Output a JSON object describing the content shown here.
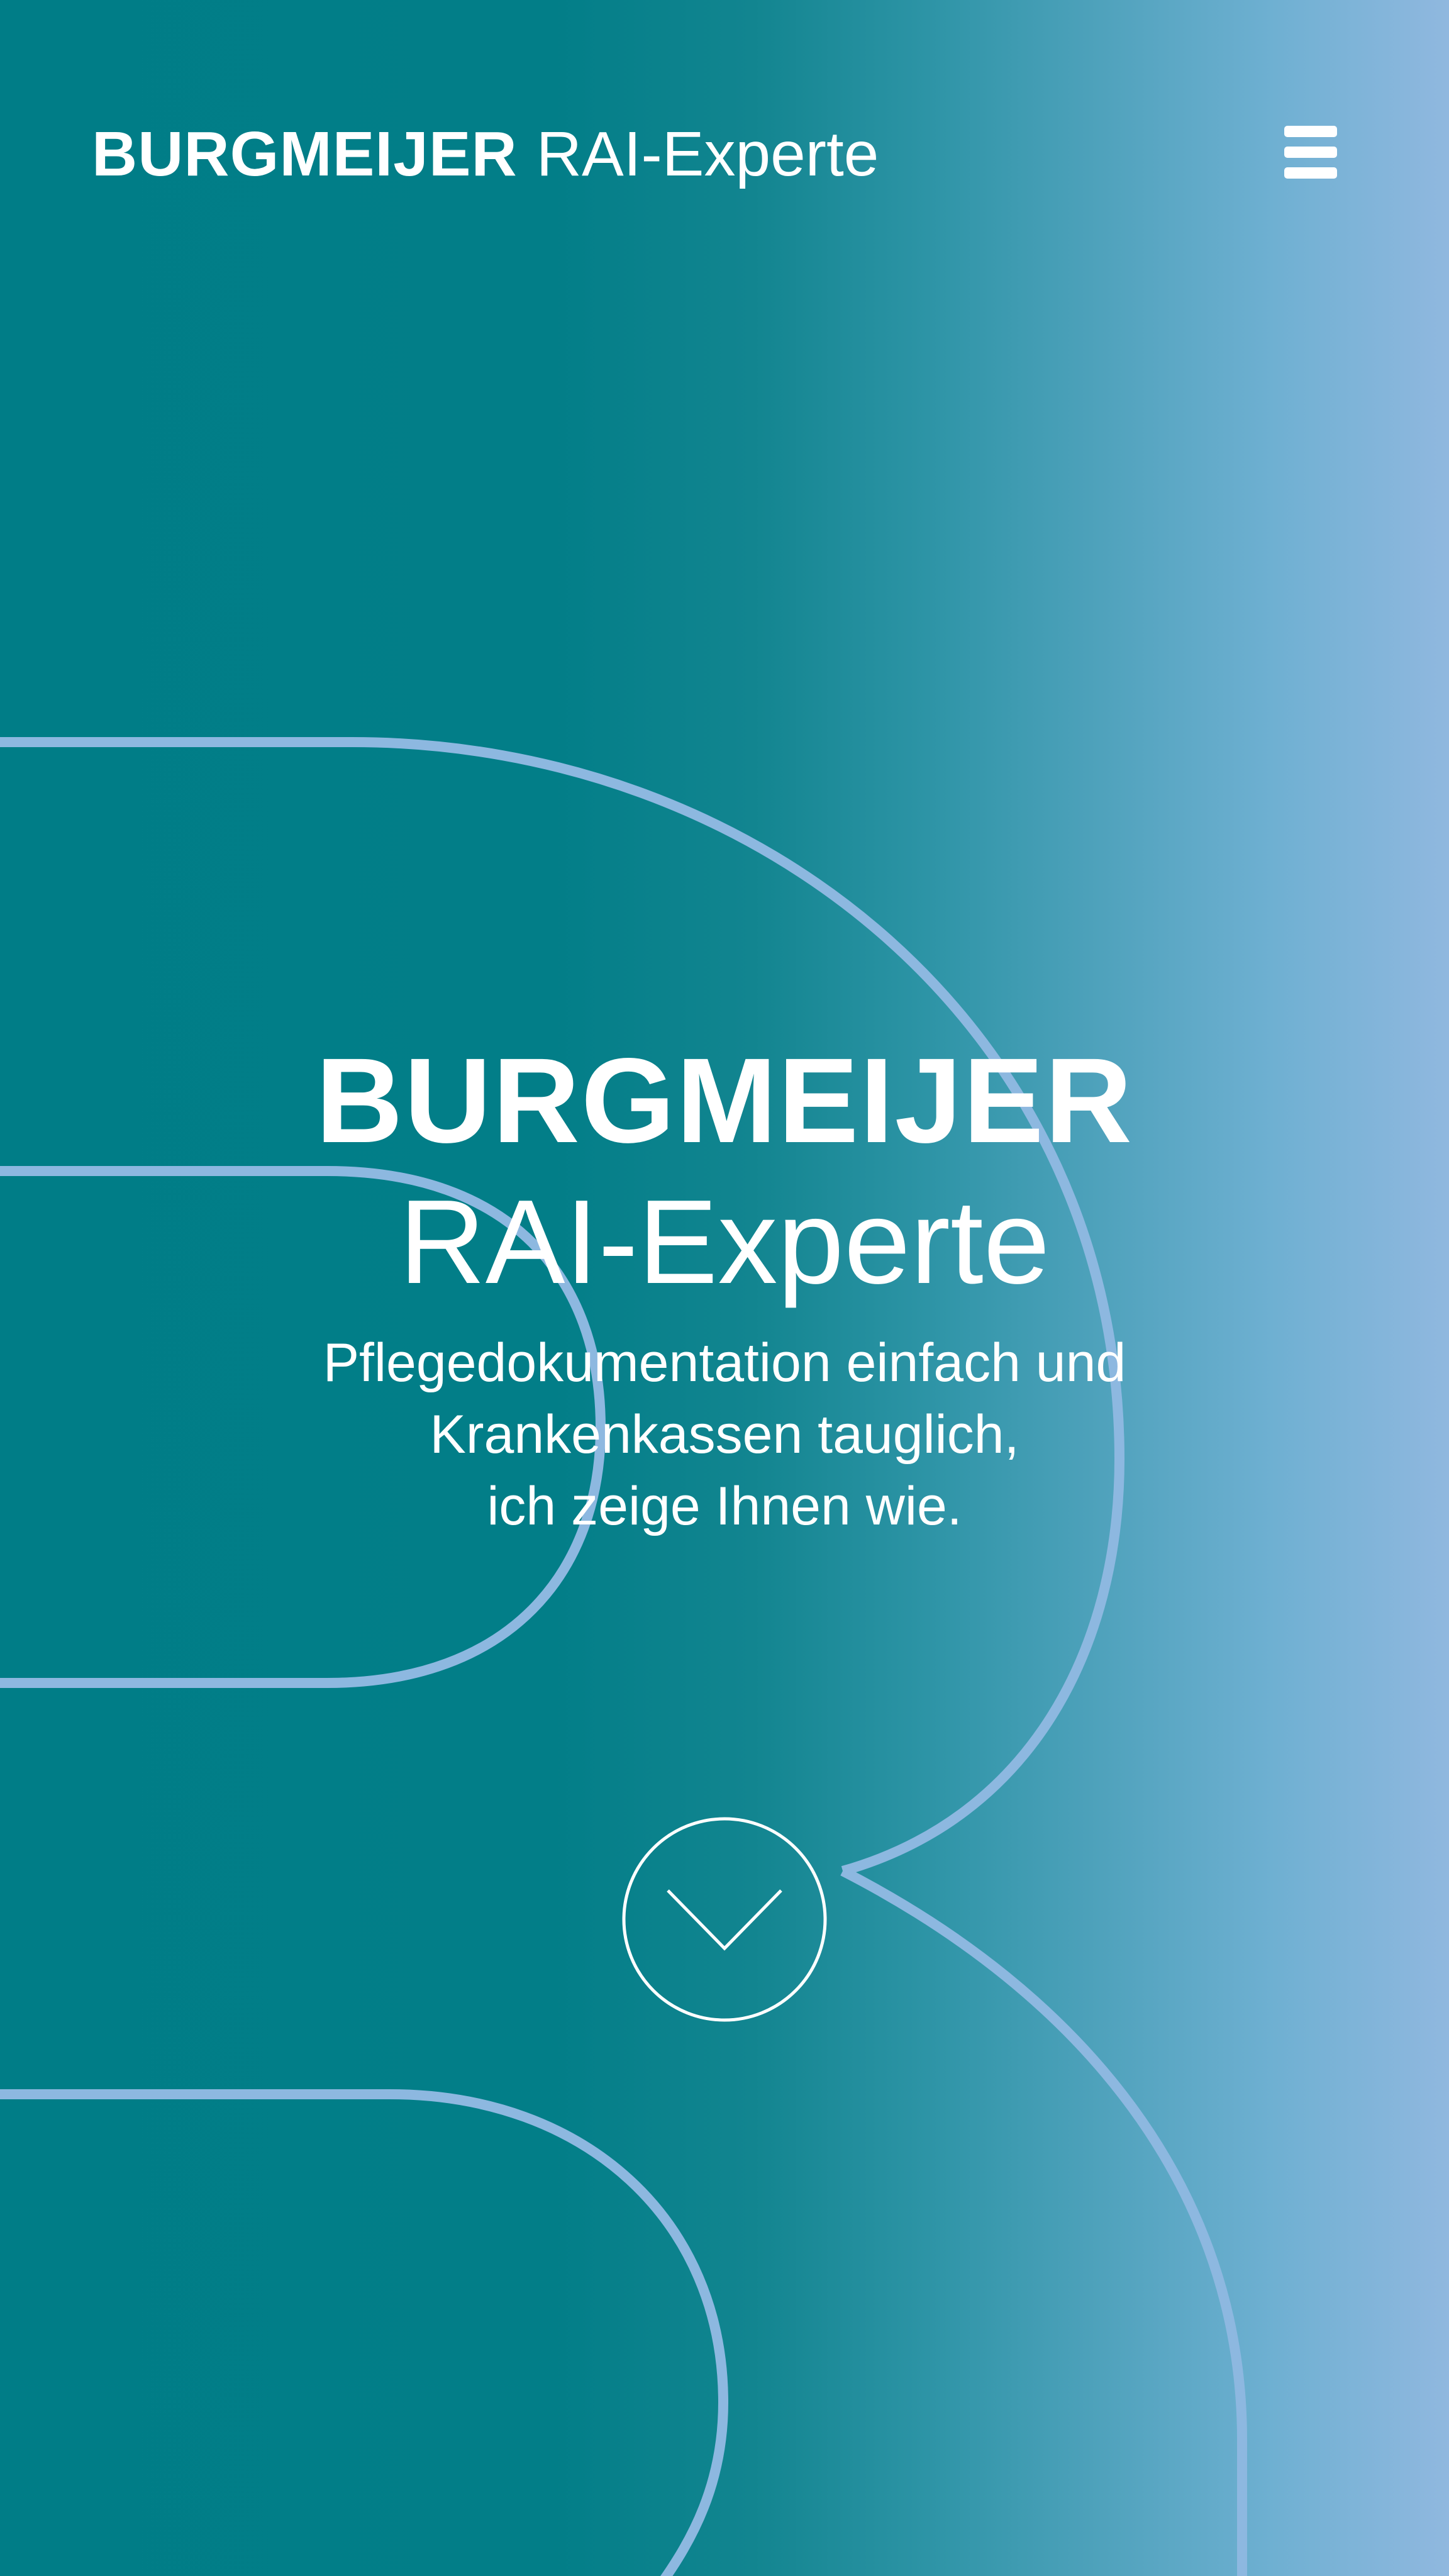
{
  "colors": {
    "gradient_start": "#007d87",
    "gradient_end": "#90b8df",
    "outline": "#8db8e0",
    "text": "#ffffff"
  },
  "header": {
    "brand_strong": "BURGMEIJER",
    "brand_light": "RAI-Experte",
    "menu_icon": "hamburger-menu-icon"
  },
  "hero": {
    "title": "BURGMEIJER",
    "subtitle": "RAI-Experte",
    "tagline_lines": [
      "Pflegedokumentation einfach und",
      "Krankenkassen tauglich,",
      "ich zeige Ihnen wie."
    ],
    "scroll_icon": "chevron-down-circle-icon"
  }
}
